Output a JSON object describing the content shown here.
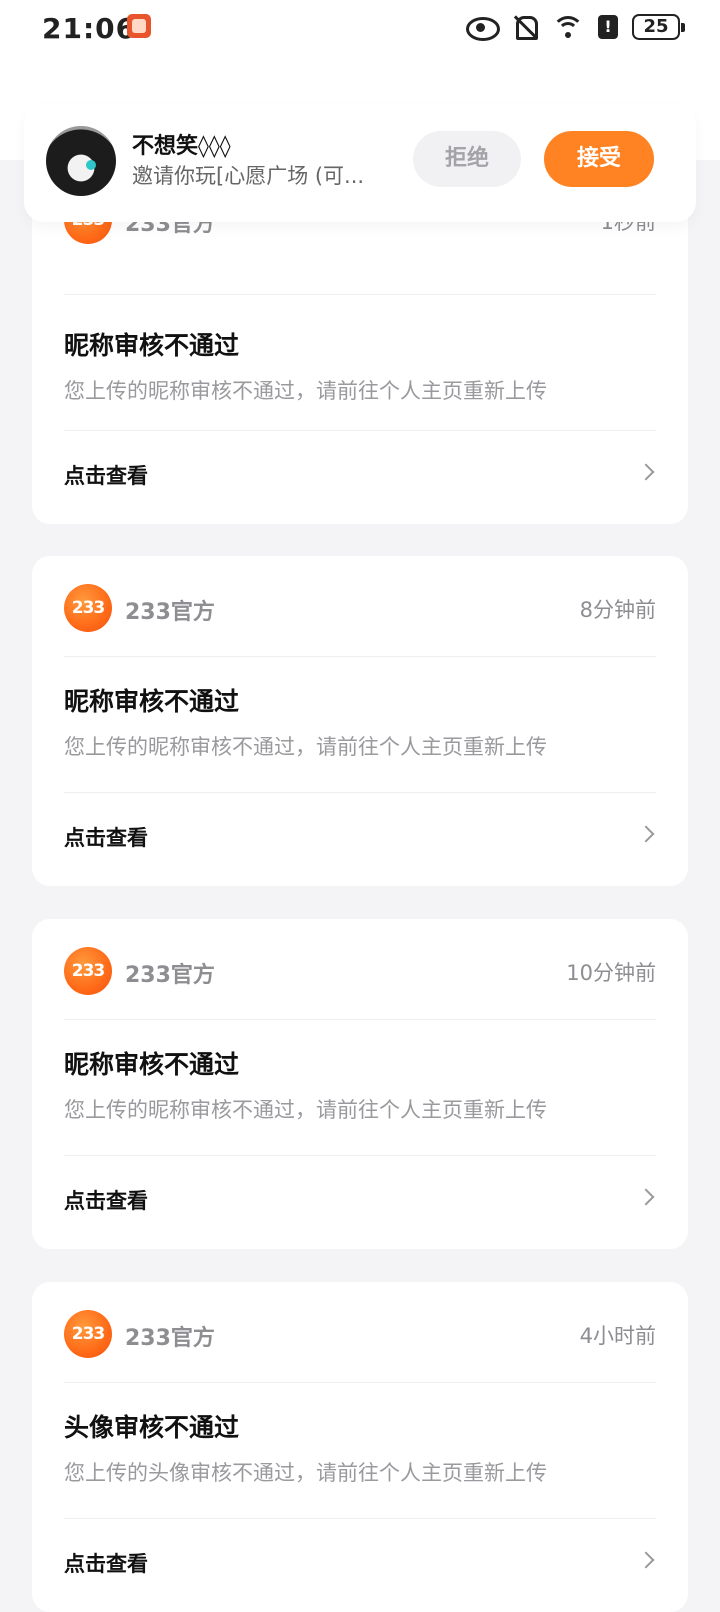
{
  "status_bar": {
    "time": "21:06",
    "battery": "25",
    "alert": "!",
    "icons": [
      "app-icon",
      "eye-icon",
      "bell-off-icon",
      "wifi-icon",
      "alert-icon",
      "battery-icon"
    ]
  },
  "invite": {
    "name": "不想笑◊◊◊",
    "message": "邀请你玩[心愿广场 (可...",
    "reject_label": "拒绝",
    "accept_label": "接受"
  },
  "colors": {
    "accent": "#ff8223",
    "brand_logo": "#ff6a18",
    "background": "#f4f4f6"
  },
  "messages": [
    {
      "logo": "233",
      "sender": "233官方",
      "time": "1秒前",
      "title": "昵称审核不通过",
      "body": "您上传的昵称审核不通过，请前往个人主页重新上传",
      "action": "点击查看"
    },
    {
      "logo": "233",
      "sender": "233官方",
      "time": "8分钟前",
      "title": "昵称审核不通过",
      "body": "您上传的昵称审核不通过，请前往个人主页重新上传",
      "action": "点击查看"
    },
    {
      "logo": "233",
      "sender": "233官方",
      "time": "10分钟前",
      "title": "昵称审核不通过",
      "body": "您上传的昵称审核不通过，请前往个人主页重新上传",
      "action": "点击查看"
    },
    {
      "logo": "233",
      "sender": "233官方",
      "time": "4小时前",
      "title": "头像审核不通过",
      "body": "您上传的头像审核不通过，请前往个人主页重新上传",
      "action": "点击查看"
    }
  ]
}
